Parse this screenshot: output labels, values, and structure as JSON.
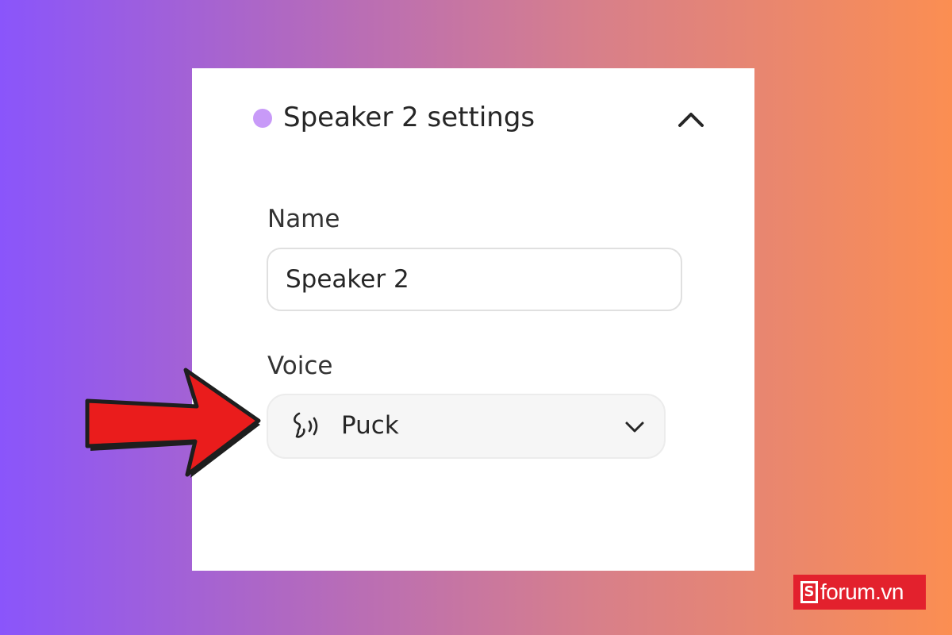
{
  "colors": {
    "speaker_dot": "#c89af8",
    "arrow_fill": "#ea1c1c",
    "arrow_outline": "#1e1e1e",
    "logo_bg": "#e3212d"
  },
  "panel": {
    "header": {
      "title": "Speaker 2 settings",
      "collapse_icon": "chevron-up-icon"
    },
    "name_field": {
      "label": "Name",
      "value": "Speaker 2"
    },
    "voice_field": {
      "label": "Voice",
      "icon": "voice-speaking-icon",
      "selected": "Puck",
      "dropdown_icon": "chevron-down-icon"
    }
  },
  "annotation": {
    "icon": "red-arrow-icon"
  },
  "watermark": {
    "mark": "S",
    "text": "forum.vn"
  }
}
